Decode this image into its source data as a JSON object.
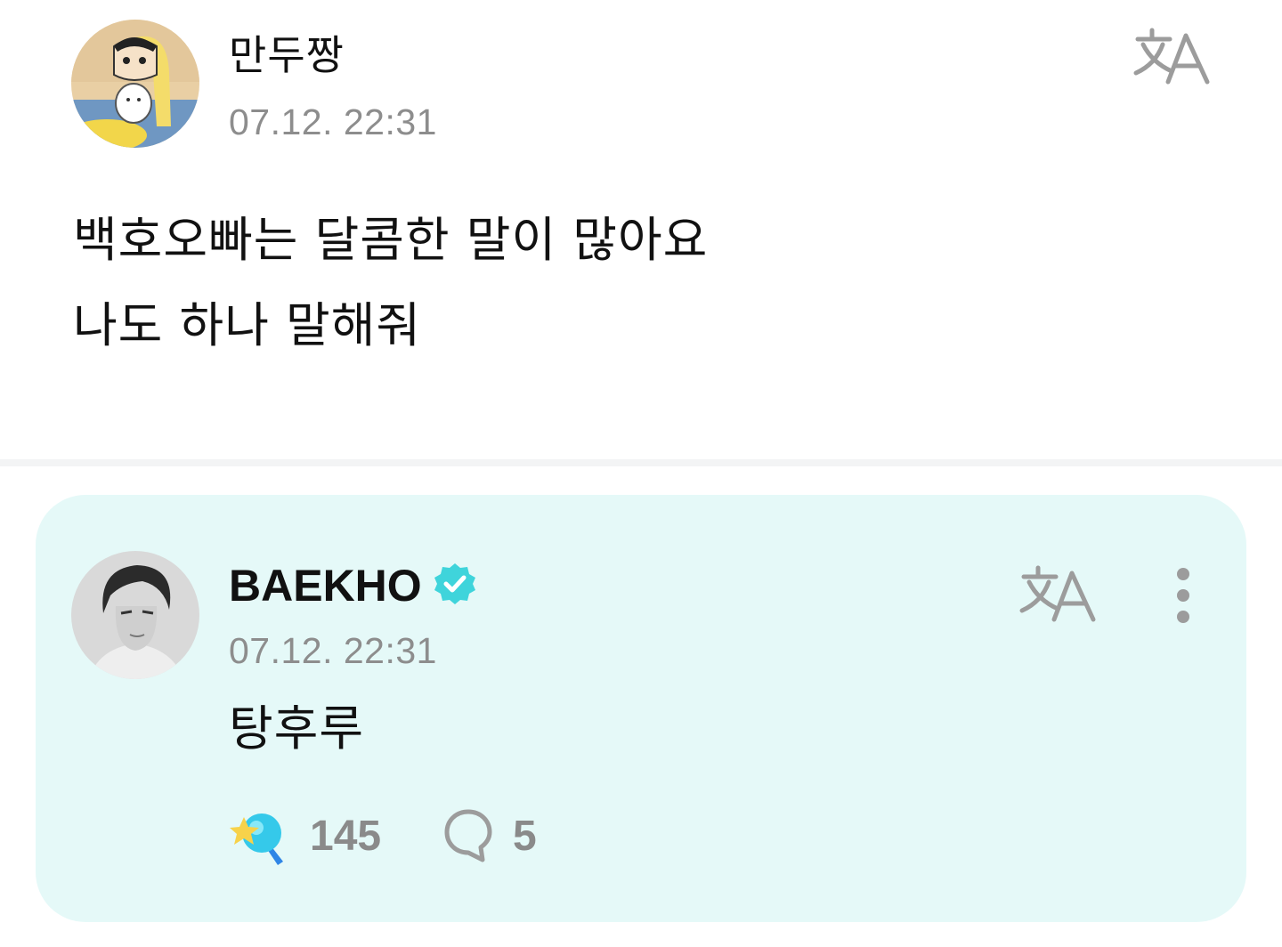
{
  "post": {
    "author": "만두짱",
    "timestamp": "07.12. 22:31",
    "avatar_icon": "cartoon-character-avatar",
    "translate_icon": "translate-icon",
    "body_lines": [
      "백호오빠는 달콤한 말이 많아요",
      "나도 하나 말해줘"
    ]
  },
  "reply": {
    "author": "BAEKHO",
    "verified": true,
    "timestamp": "07.12. 22:31",
    "avatar_icon": "profile-photo-avatar",
    "translate_icon": "translate-icon",
    "more_icon": "more-vertical-icon",
    "body": "탕후루",
    "likes": "145",
    "comments": "5",
    "like_icon": "lightstick-like-icon",
    "comment_icon": "comment-bubble-icon"
  },
  "colors": {
    "card_background": "#e5f9f8",
    "verified_badge": "#3fd4db",
    "secondary_text": "#8d8d8d",
    "icon_gray": "#9c9c9c"
  }
}
